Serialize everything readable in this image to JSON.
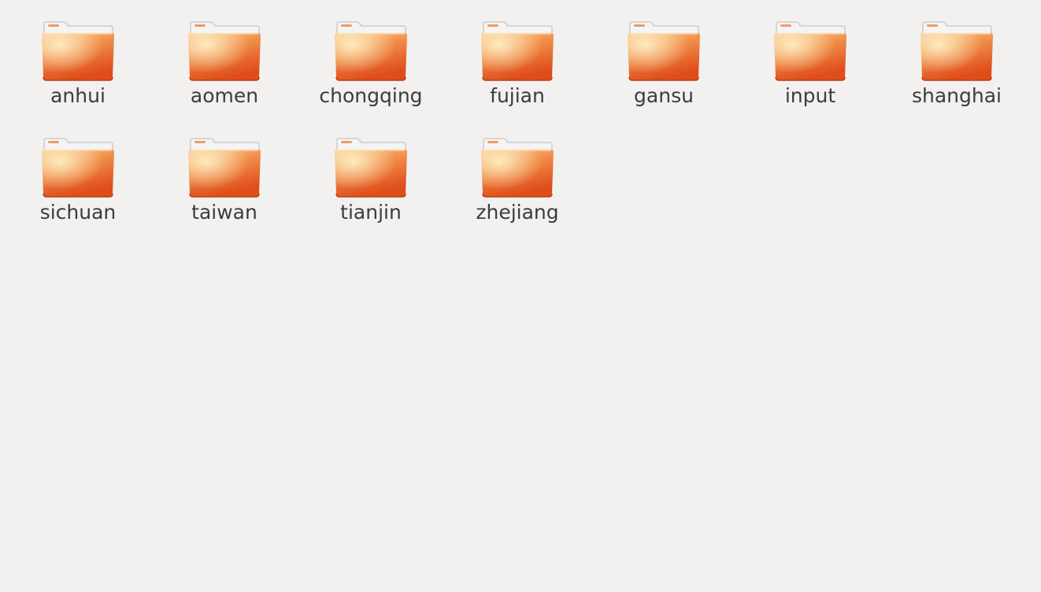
{
  "window": {
    "background": "#f2f1f0"
  },
  "folders": [
    {
      "label": "anhui",
      "icon": "folder-icon"
    },
    {
      "label": "aomen",
      "icon": "folder-icon"
    },
    {
      "label": "chongqing",
      "icon": "folder-icon"
    },
    {
      "label": "fujian",
      "icon": "folder-icon"
    },
    {
      "label": "gansu",
      "icon": "folder-icon"
    },
    {
      "label": "input",
      "icon": "folder-icon"
    },
    {
      "label": "shanghai",
      "icon": "folder-icon"
    },
    {
      "label": "sichuan",
      "icon": "folder-icon"
    },
    {
      "label": "taiwan",
      "icon": "folder-icon"
    },
    {
      "label": "tianjin",
      "icon": "folder-icon"
    },
    {
      "label": "zhejiang",
      "icon": "folder-icon"
    }
  ],
  "colors": {
    "folder_top": "#f7b978",
    "folder_bottom": "#e0531f",
    "label_text": "#3c3c3c"
  }
}
